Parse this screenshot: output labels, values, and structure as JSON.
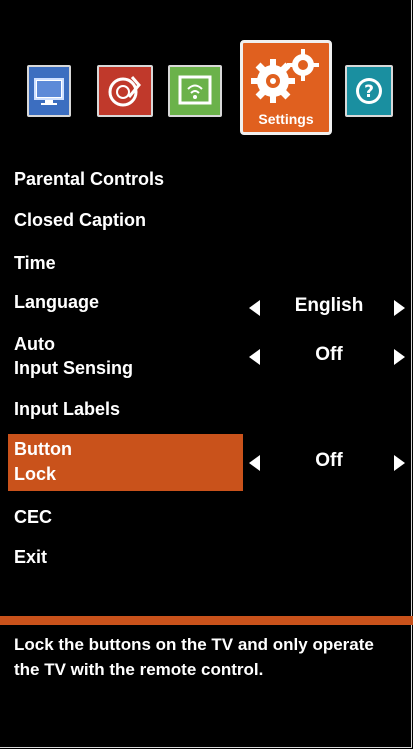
{
  "icons": {
    "tv": {
      "name": "picture-icon",
      "color": "#3c6ec0"
    },
    "media": {
      "name": "audio-icon",
      "color": "#c0392b"
    },
    "network": {
      "name": "network-icon",
      "color": "#6bb24a"
    },
    "settings": {
      "name": "gear-icon",
      "label": "Settings",
      "color": "#e0601f"
    },
    "help": {
      "name": "help-icon",
      "color": "#1a8fa0"
    }
  },
  "menu": {
    "parental_controls": "Parental Controls",
    "closed_caption": "Closed Caption",
    "time": "Time",
    "language": "Language",
    "auto_input_line1": "Auto",
    "auto_input_line2": "Input Sensing",
    "input_labels": "Input Labels",
    "button_lock_line1": "Button",
    "button_lock_line2": "Lock",
    "cec": "CEC",
    "exit": "Exit"
  },
  "values": {
    "language": "English",
    "auto_input_sensing": "Off",
    "button_lock": "Off"
  },
  "description": "Lock the buttons on the TV and only operate the TV with the remote control.",
  "colors": {
    "highlight": "#c9521b",
    "background": "#000000"
  }
}
